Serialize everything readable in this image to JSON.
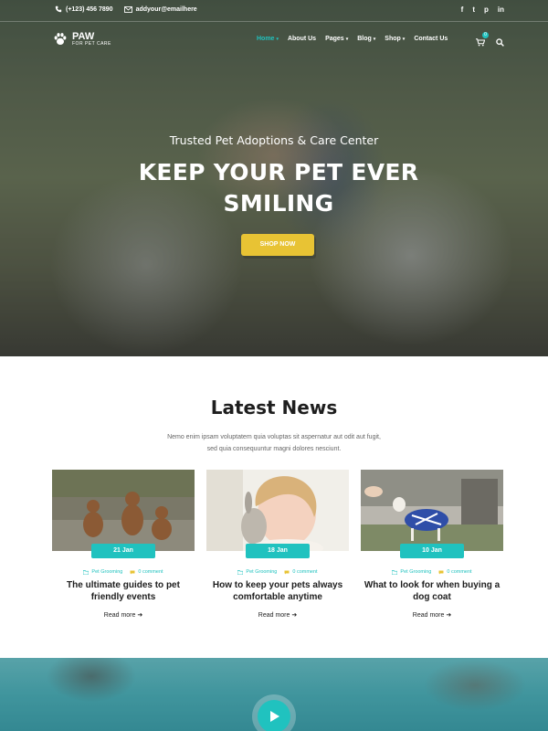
{
  "colors": {
    "accent": "#20c2bf",
    "button": "#e8c334"
  },
  "topbar": {
    "phone": "(+123) 456 7890",
    "email": "addyour@emailhere",
    "social": [
      "f",
      "t",
      "p",
      "in"
    ],
    "social_icons": [
      "facebook-icon",
      "twitter-icon",
      "pinterest-icon",
      "linkedin-icon"
    ]
  },
  "logo": {
    "name": "PAW",
    "tagline": "FOR PET CARE"
  },
  "nav": {
    "items": [
      {
        "label": "Home"
      },
      {
        "label": "About Us"
      },
      {
        "label": "Pages"
      },
      {
        "label": "Blog"
      },
      {
        "label": "Shop"
      },
      {
        "label": "Contact Us"
      }
    ],
    "cart_count": "0"
  },
  "hero": {
    "subtitle": "Trusted Pet Adoptions & Care Center",
    "title": "KEEP YOUR PET EVER SMILING",
    "button": "SHOP NOW"
  },
  "news": {
    "title": "Latest News",
    "description": "Nemo enim ipsam voluptatem quia voluptas sit aspernatur aut odit aut fugit, sed quia consequuntur magni dolores nesciunt.",
    "cards": [
      {
        "date": "21 Jan",
        "category": "Pet Grooming",
        "comments": "0 comment",
        "title": "The ultimate guides to pet friendly events",
        "more": "Read more"
      },
      {
        "date": "18 Jan",
        "category": "Pet Grooming",
        "comments": "0 comment",
        "title": "How to keep your pets always comfortable anytime",
        "more": "Read more"
      },
      {
        "date": "10 Jan",
        "category": "Pet Grooming",
        "comments": "0 comment",
        "title": "What to look for when buying a dog coat",
        "more": "Read more"
      }
    ]
  }
}
